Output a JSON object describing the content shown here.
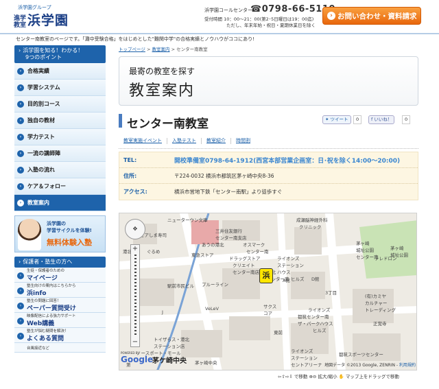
{
  "header": {
    "group_label": "浜学園グループ",
    "logo_sub_1": "進学",
    "logo_sub_2": "教室",
    "logo_name": "浜学園",
    "call_center_label": "浜学園コールセンター",
    "phone": "0798-66-5110",
    "hours_1": "受付時間 10：00〜21：00(第2･5日曜日は19：00迄)",
    "hours_2": "ただし、年末年始・祝日・夏期休業日を除く",
    "contact_button": "お問い合わせ・資料請求"
  },
  "tagline": "センター南教室のページです。「灘中受験合格」をはじめとした\"難関中学\"の合格実績とノウハウがココにあり!",
  "sidebar": {
    "head_1": "浜学園を知る！わかる！",
    "head_2": "9つのポイント",
    "items": [
      {
        "label": "合格実績"
      },
      {
        "label": "学習システム"
      },
      {
        "label": "目的別コース"
      },
      {
        "label": "独自の教材"
      },
      {
        "label": "学力テスト"
      },
      {
        "label": "一流の講師陣"
      },
      {
        "label": "入塾の流れ"
      },
      {
        "label": "ケア＆フォロー"
      },
      {
        "label": "教室案内"
      }
    ],
    "banner": {
      "line1": "浜学園の",
      "line2": "学習サイクルを体験!",
      "line3": "無料体験入塾"
    },
    "guardian_head": "保護者・塾生の方へ",
    "sub_items": [
      {
        "small": "生徒・保護者のための",
        "big": "マイページ"
      },
      {
        "small": "塾生向けの案内はこちらから",
        "big": "浜info"
      },
      {
        "small": "塾生の問題に回答！",
        "big": "ペーパー質問受け"
      },
      {
        "small": "映像配信による強力サポート",
        "big": "Web講義"
      },
      {
        "small": "塾生が悩む疑問を解決！",
        "big": "よくある質問"
      }
    ],
    "partial_item": "台風接近など"
  },
  "breadcrumb": {
    "top": "トップページ",
    "sep": ">",
    "classroom_guide": "教室案内",
    "current": "センター南教室"
  },
  "title_box": {
    "small": "最寄の教室を探す",
    "big": "教室案内"
  },
  "school": {
    "name": "センター南教室",
    "tweet": "ツイート",
    "tweet_count": "0",
    "like": "いいね！",
    "like_count": "0"
  },
  "subnav": [
    "教室実施イベント",
    "入塾テスト",
    "教室紹介",
    "時間割"
  ],
  "info": [
    {
      "label": "TEL:",
      "value": "開校準備室0798-64-1912(西宮本部営業企画室：日･祝を除く14:00〜20:00)"
    },
    {
      "label": "住所:",
      "value": "〒224-0032 横浜市都筑区茅ヶ崎中央8-36"
    },
    {
      "label": "アクセス:",
      "value": "横浜市営地下鉄「センター南駅」より徒歩すぐ"
    }
  ],
  "map": {
    "labels": [
      "ニューターウン文庫",
      "三井住友銀行",
      "センター南支店",
      "ピアしま寿司",
      "港北",
      "ぐるめ",
      "あうの港北",
      "東急ストア",
      "成瀬脳神経外科",
      "クリニック",
      "茅ヶ崎",
      "城址公園",
      "オスマーク",
      "センター南",
      "茅ヶ崎",
      "城址公園",
      "センター南",
      "駅前市民ビル",
      "プルーライン",
      "ドラッグストア",
      "クリエイト",
      "センター南店",
      "ライオンズ",
      "ステーション",
      "ハウス",
      "ヒルズ",
      "港北",
      "センター南",
      "A館",
      "D館",
      "3丁目",
      "テレドロン",
      "J",
      "VeLeV",
      "サクス",
      "コア",
      "(有)カミヤ",
      "カルチャー",
      "トレーディング",
      "ライオンズ",
      "都筑センター南",
      "ザ・パークハウス",
      "ヒルズ",
      "正覚寺",
      "トイザらス・港北",
      "ステーション店",
      "ノースポート・モール",
      "ライオンズ",
      "ステーション",
      "セントアリーナ",
      "東前",
      "茅ヶ崎中央",
      "都筑スポーツセンター",
      "第"
    ],
    "marker": "浜",
    "google": "Google",
    "place": "茅ケ崎中央",
    "powered_by": "POWERED BY",
    "copyright": "地図データ ©2013 Google, ZENRIN -",
    "terms": "利用規約",
    "help_move": "で移動",
    "help_zoom": "拡大/縮小",
    "help_drag": "マップ上をドラッグで移動"
  },
  "colors": {
    "brand_blue": "#1e63ab",
    "accent_orange": "#e8670d",
    "info_bg": "#fdf6e2",
    "tel_blue": "#3a86d0"
  }
}
